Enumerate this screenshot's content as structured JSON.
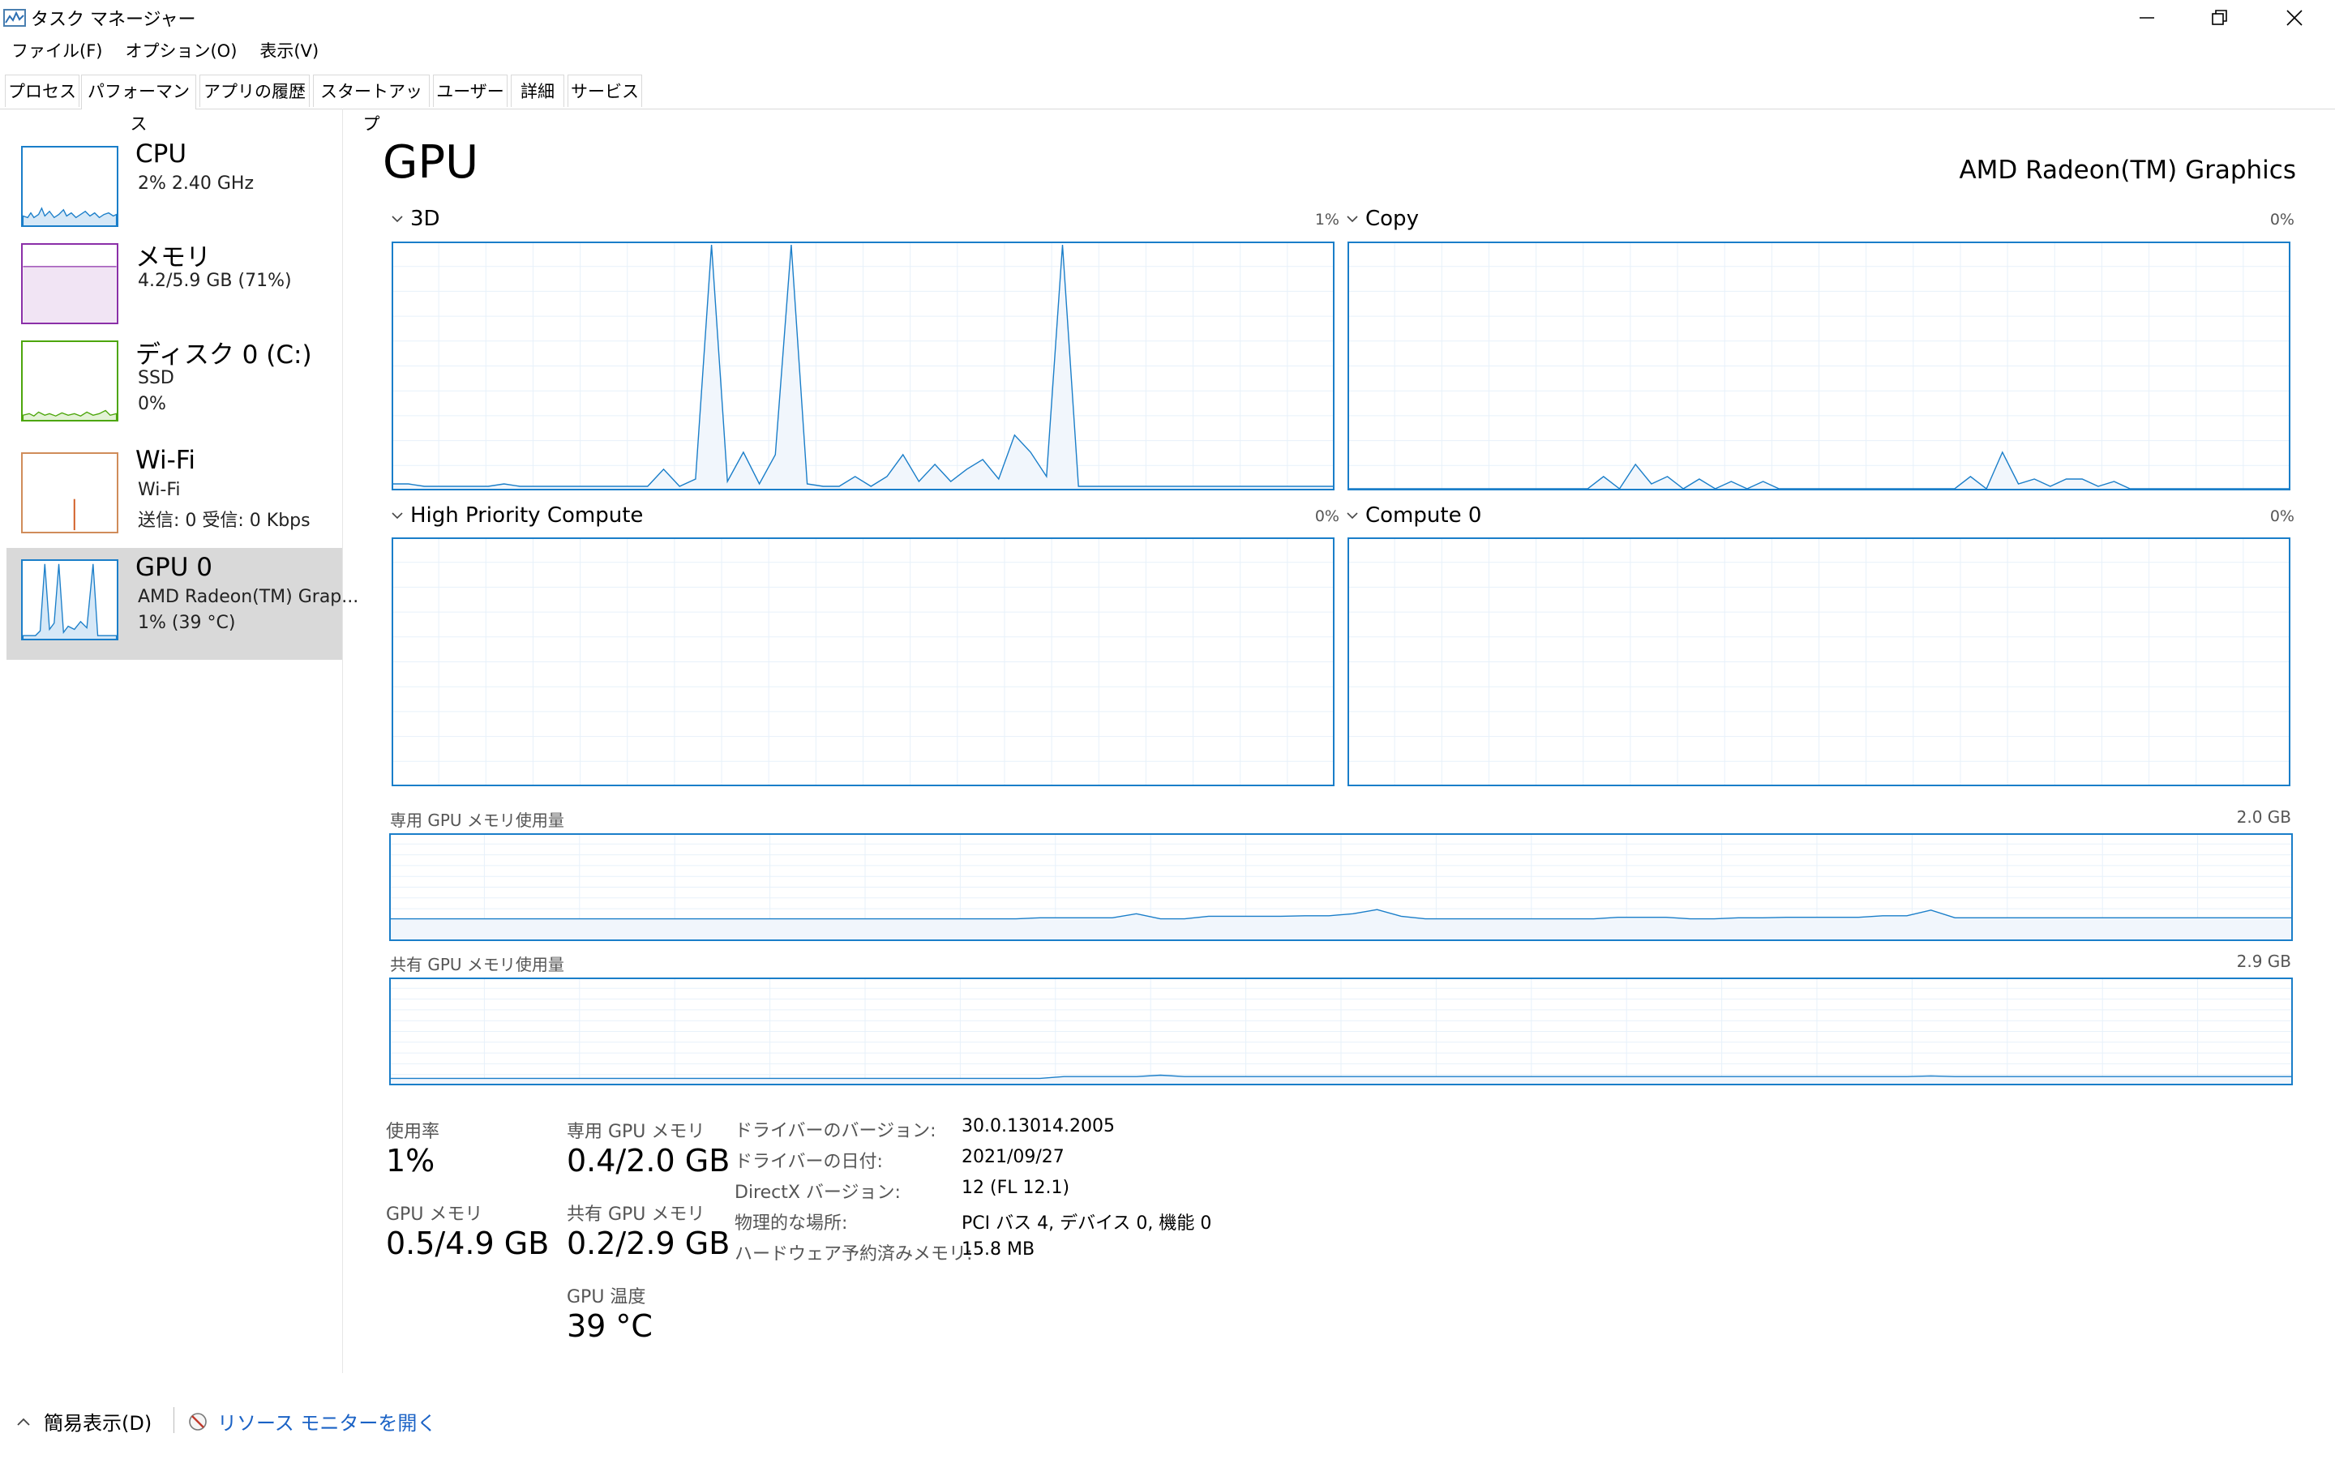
{
  "window": {
    "title": "タスク マネージャー",
    "icons": {
      "app": "task-manager-icon",
      "minimize": "minimize-icon",
      "restore": "restore-icon",
      "close": "close-icon"
    }
  },
  "menu": [
    "ファイル(F)",
    "オプション(O)",
    "表示(V)"
  ],
  "tabs": [
    "プロセス",
    "パフォーマンス",
    "アプリの履歴",
    "スタートアップ",
    "ユーザー",
    "詳細",
    "サービス"
  ],
  "active_tab": "パフォーマンス",
  "sidebar": [
    {
      "name": "CPU",
      "line2": "2%  2.40 GHz",
      "line3": "",
      "color": "#1a7ec9"
    },
    {
      "name": "メモリ",
      "line2": "4.2/5.9 GB (71%)",
      "line3": "",
      "color": "#8b2fa8"
    },
    {
      "name": "ディスク 0 (C:)",
      "line2": "SSD",
      "line3": "0%",
      "color": "#4da60c"
    },
    {
      "name": "Wi-Fi",
      "line2": "Wi-Fi",
      "line3": "送信: 0  受信: 0 Kbps",
      "color": "#a74f01"
    },
    {
      "name": "GPU 0",
      "line2": "AMD Radeon(TM) Grap...",
      "line3": "1%  (39 °C)",
      "color": "#1a7ec9",
      "selected": true
    }
  ],
  "main": {
    "title": "GPU",
    "device": "AMD Radeon(TM) Graphics",
    "engines": [
      {
        "label": "3D",
        "pct": "1%"
      },
      {
        "label": "Copy",
        "pct": "0%"
      },
      {
        "label": "High Priority Compute",
        "pct": "0%"
      },
      {
        "label": "Compute 0",
        "pct": "0%"
      }
    ],
    "dedicated": {
      "label": "専用 GPU メモリ使用量",
      "max": "2.0 GB"
    },
    "shared": {
      "label": "共有 GPU メモリ使用量",
      "max": "2.9 GB"
    }
  },
  "stats": {
    "usage_label": "使用率",
    "usage_value": "1%",
    "gpu_mem_label": "GPU メモリ",
    "gpu_mem_value": "0.5/4.9 GB",
    "dedicated_label": "専用 GPU メモリ",
    "dedicated_value": "0.4/2.0 GB",
    "shared_label": "共有 GPU メモリ",
    "shared_value": "0.2/2.9 GB",
    "temp_label": "GPU 温度",
    "temp_value": "39 °C"
  },
  "info": [
    {
      "label": "ドライバーのバージョン:",
      "value": "30.0.13014.2005"
    },
    {
      "label": "ドライバーの日付:",
      "value": "2021/09/27"
    },
    {
      "label": "DirectX バージョン:",
      "value": "12 (FL 12.1)"
    },
    {
      "label": "物理的な場所:",
      "value": "PCI バス 4, デバイス 0, 機能 0"
    },
    {
      "label": "ハードウェア予約済みメモリ:",
      "value": "15.8 MB"
    }
  ],
  "footer": {
    "toggle_label": "簡易表示(D)",
    "link_label": "リソース モニターを開く",
    "icons": {
      "chevron": "chevron-up-icon",
      "monitor": "resource-monitor-icon"
    }
  },
  "chart_data": [
    {
      "type": "area",
      "title": "3D",
      "ylim": [
        0,
        100
      ],
      "values": [
        2,
        2,
        1,
        1,
        1,
        1,
        1,
        2,
        1,
        1,
        1,
        1,
        1,
        1,
        1,
        1,
        1,
        8,
        1,
        4,
        100,
        3,
        15,
        2,
        14,
        100,
        2,
        1,
        1,
        5,
        1,
        5,
        14,
        3,
        10,
        3,
        8,
        12,
        4,
        22,
        15,
        5,
        100,
        1,
        1,
        1,
        1,
        1,
        1,
        1,
        1,
        1,
        1,
        1,
        1,
        1,
        1,
        1,
        1,
        1
      ]
    },
    {
      "type": "area",
      "title": "Copy",
      "ylim": [
        0,
        100
      ],
      "values": [
        0,
        0,
        0,
        0,
        0,
        0,
        0,
        0,
        0,
        0,
        0,
        0,
        0,
        0,
        0,
        0,
        5,
        0,
        10,
        2,
        5,
        0,
        4,
        0,
        3,
        0,
        3,
        0,
        0,
        0,
        0,
        0,
        0,
        0,
        0,
        0,
        0,
        0,
        0,
        5,
        0,
        15,
        2,
        4,
        1,
        4,
        4,
        1,
        3,
        0,
        0,
        0,
        0,
        0,
        0,
        0,
        0,
        0,
        0,
        0
      ]
    },
    {
      "type": "area",
      "title": "High Priority Compute",
      "ylim": [
        0,
        100
      ],
      "values": []
    },
    {
      "type": "area",
      "title": "Compute 0",
      "ylim": [
        0,
        100
      ],
      "values": []
    },
    {
      "type": "area",
      "title": "専用 GPU メモリ使用量",
      "ylim": [
        0,
        2.0
      ],
      "values": [
        0.4,
        0.4,
        0.4,
        0.4,
        0.4,
        0.4,
        0.4,
        0.4,
        0.4,
        0.4,
        0.4,
        0.4,
        0.4,
        0.4,
        0.4,
        0.4,
        0.4,
        0.4,
        0.4,
        0.4,
        0.4,
        0.4,
        0.4,
        0.4,
        0.4,
        0.4,
        0.4,
        0.42,
        0.42,
        0.42,
        0.42,
        0.5,
        0.4,
        0.4,
        0.45,
        0.45,
        0.45,
        0.45,
        0.46,
        0.46,
        0.5,
        0.58,
        0.45,
        0.4,
        0.4,
        0.4,
        0.4,
        0.4,
        0.4,
        0.4,
        0.4,
        0.43,
        0.43,
        0.43,
        0.4,
        0.4,
        0.42,
        0.42,
        0.43,
        0.43,
        0.43,
        0.43,
        0.46,
        0.46,
        0.57,
        0.42,
        0.42,
        0.42,
        0.42,
        0.42,
        0.42,
        0.42,
        0.42,
        0.42,
        0.42,
        0.42,
        0.42,
        0.42,
        0.42,
        0.42
      ]
    },
    {
      "type": "area",
      "title": "共有 GPU メモリ使用量",
      "ylim": [
        0,
        2.9
      ],
      "values": [
        0.15,
        0.15,
        0.15,
        0.15,
        0.15,
        0.15,
        0.15,
        0.15,
        0.15,
        0.15,
        0.15,
        0.15,
        0.15,
        0.15,
        0.15,
        0.15,
        0.15,
        0.15,
        0.15,
        0.15,
        0.15,
        0.15,
        0.15,
        0.15,
        0.15,
        0.15,
        0.15,
        0.15,
        0.2,
        0.2,
        0.2,
        0.2,
        0.24,
        0.2,
        0.2,
        0.2,
        0.2,
        0.2,
        0.2,
        0.2,
        0.2,
        0.2,
        0.2,
        0.2,
        0.2,
        0.2,
        0.2,
        0.2,
        0.2,
        0.2,
        0.2,
        0.2,
        0.2,
        0.2,
        0.2,
        0.2,
        0.2,
        0.2,
        0.2,
        0.2,
        0.2,
        0.2,
        0.2,
        0.2,
        0.22,
        0.2,
        0.2,
        0.2,
        0.2,
        0.2,
        0.2,
        0.2,
        0.2,
        0.2,
        0.2,
        0.2,
        0.2,
        0.2,
        0.2,
        0.2
      ]
    }
  ]
}
